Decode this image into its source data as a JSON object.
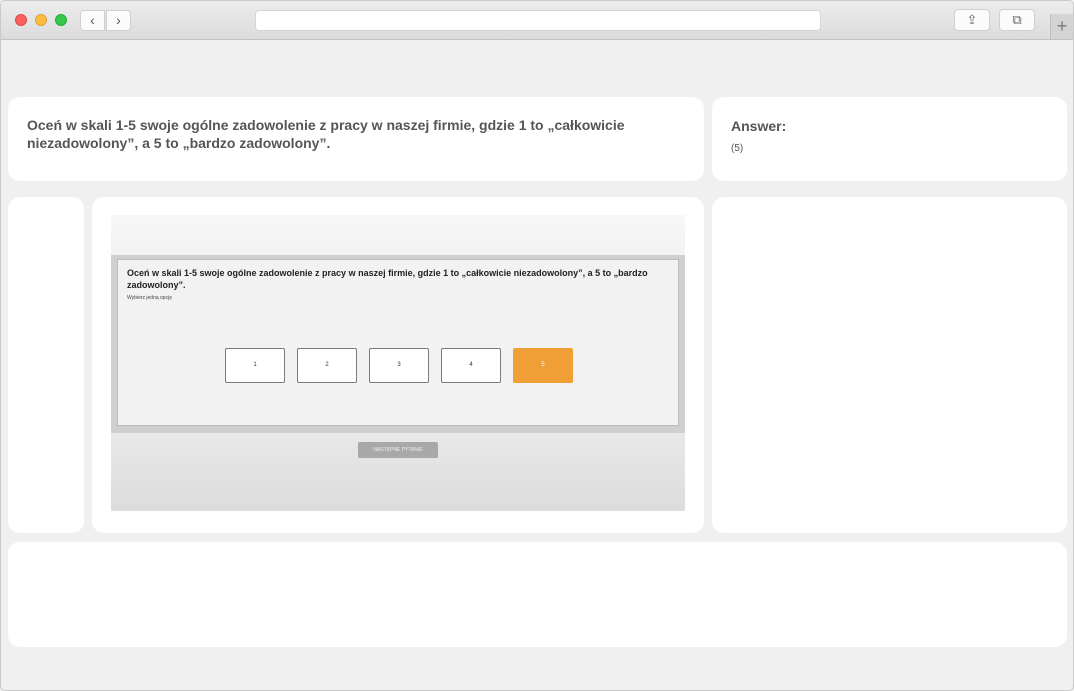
{
  "browser": {
    "back_glyph": "‹",
    "forward_glyph": "›",
    "share_glyph": "⇪",
    "tabs_glyph": "⧉",
    "new_tab_glyph": "+"
  },
  "question_panel": {
    "text": "Oceń w skali 1-5 swoje ogólne zadowolenie z pracy w naszej firmie, gdzie 1 to „całkowicie niezadowolony”, a 5 to „bardzo zadowolony”."
  },
  "answer_panel": {
    "heading": "Answer:",
    "value": "(5)"
  },
  "survey": {
    "question": "Oceń w skali 1-5 swoje ogólne zadowolenie z pracy w naszej firmie, gdzie 1 to „całkowicie niezadowolony”, a 5 to „bardzo zadowolony”.",
    "hint": "Wybierz jedną opcję",
    "options": [
      "1",
      "2",
      "3",
      "4",
      "5"
    ],
    "selected": "5",
    "next_label": "NASTĘPNE PYTANIE"
  },
  "colors": {
    "accent": "#ef9f36",
    "panel": "#ffffff",
    "background": "#f0f0f0"
  }
}
